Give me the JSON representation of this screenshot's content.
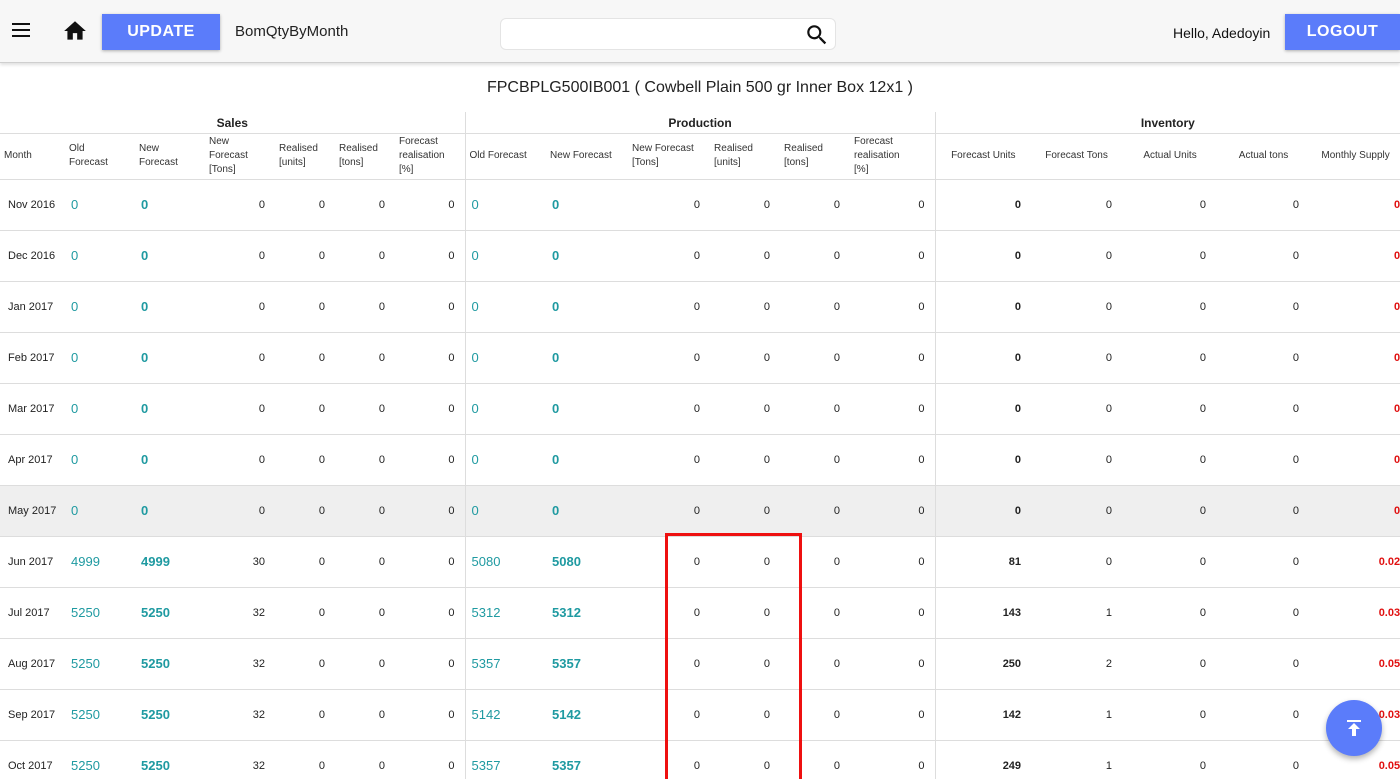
{
  "topbar": {
    "update_label": "UPDATE",
    "page_name": "BomQtyByMonth",
    "search_value": "",
    "greeting": "Hello, Adedoyin",
    "logout_label": "LOGOUT"
  },
  "product_title": "FPCBPLG500IB001 ( Cowbell Plain 500 gr Inner Box 12x1 )",
  "groups": {
    "sales": "Sales",
    "production": "Production",
    "inventory": "Inventory"
  },
  "columns": {
    "month": "Month",
    "sales": [
      "Old\nForecast",
      "New\nForecast",
      "New\nForecast\n[Tons]",
      "Realised\n[units]",
      "Realised\n[tons]",
      "Forecast\nrealisation\n[%]"
    ],
    "production": [
      "Old Forecast",
      "New Forecast",
      "New Forecast\n[Tons]",
      "Realised\n[units]",
      "Realised\n[tons]",
      "Forecast\nrealisation\n[%]"
    ],
    "inventory": [
      "Forecast Units",
      "Forecast Tons",
      "Actual Units",
      "Actual tons",
      "Monthly Supply"
    ]
  },
  "rows": [
    {
      "month": "Nov 2016",
      "s_old": "0",
      "s_new": "0",
      "s_tons": "0",
      "s_real_units": "0",
      "s_real_tons": "0",
      "s_pct": "0",
      "p_old": "0",
      "p_new": "0",
      "p_tons": "0",
      "p_real_units": "0",
      "p_real_tons": "0",
      "p_pct": "0",
      "i_fc_units": "0",
      "i_fc_tons": "0",
      "i_act_units": "0",
      "i_act_tons": "0",
      "i_supply": "0"
    },
    {
      "month": "Dec 2016",
      "s_old": "0",
      "s_new": "0",
      "s_tons": "0",
      "s_real_units": "0",
      "s_real_tons": "0",
      "s_pct": "0",
      "p_old": "0",
      "p_new": "0",
      "p_tons": "0",
      "p_real_units": "0",
      "p_real_tons": "0",
      "p_pct": "0",
      "i_fc_units": "0",
      "i_fc_tons": "0",
      "i_act_units": "0",
      "i_act_tons": "0",
      "i_supply": "0"
    },
    {
      "month": "Jan 2017",
      "s_old": "0",
      "s_new": "0",
      "s_tons": "0",
      "s_real_units": "0",
      "s_real_tons": "0",
      "s_pct": "0",
      "p_old": "0",
      "p_new": "0",
      "p_tons": "0",
      "p_real_units": "0",
      "p_real_tons": "0",
      "p_pct": "0",
      "i_fc_units": "0",
      "i_fc_tons": "0",
      "i_act_units": "0",
      "i_act_tons": "0",
      "i_supply": "0"
    },
    {
      "month": "Feb 2017",
      "s_old": "0",
      "s_new": "0",
      "s_tons": "0",
      "s_real_units": "0",
      "s_real_tons": "0",
      "s_pct": "0",
      "p_old": "0",
      "p_new": "0",
      "p_tons": "0",
      "p_real_units": "0",
      "p_real_tons": "0",
      "p_pct": "0",
      "i_fc_units": "0",
      "i_fc_tons": "0",
      "i_act_units": "0",
      "i_act_tons": "0",
      "i_supply": "0"
    },
    {
      "month": "Mar 2017",
      "s_old": "0",
      "s_new": "0",
      "s_tons": "0",
      "s_real_units": "0",
      "s_real_tons": "0",
      "s_pct": "0",
      "p_old": "0",
      "p_new": "0",
      "p_tons": "0",
      "p_real_units": "0",
      "p_real_tons": "0",
      "p_pct": "0",
      "i_fc_units": "0",
      "i_fc_tons": "0",
      "i_act_units": "0",
      "i_act_tons": "0",
      "i_supply": "0"
    },
    {
      "month": "Apr 2017",
      "s_old": "0",
      "s_new": "0",
      "s_tons": "0",
      "s_real_units": "0",
      "s_real_tons": "0",
      "s_pct": "0",
      "p_old": "0",
      "p_new": "0",
      "p_tons": "0",
      "p_real_units": "0",
      "p_real_tons": "0",
      "p_pct": "0",
      "i_fc_units": "0",
      "i_fc_tons": "0",
      "i_act_units": "0",
      "i_act_tons": "0",
      "i_supply": "0"
    },
    {
      "month": "May 2017",
      "s_old": "0",
      "s_new": "0",
      "s_tons": "0",
      "s_real_units": "0",
      "s_real_tons": "0",
      "s_pct": "0",
      "p_old": "0",
      "p_new": "0",
      "p_tons": "0",
      "p_real_units": "0",
      "p_real_tons": "0",
      "p_pct": "0",
      "i_fc_units": "0",
      "i_fc_tons": "0",
      "i_act_units": "0",
      "i_act_tons": "0",
      "i_supply": "0",
      "highlight": true
    },
    {
      "month": "Jun 2017",
      "s_old": "4999",
      "s_new": "4999",
      "s_tons": "30",
      "s_real_units": "0",
      "s_real_tons": "0",
      "s_pct": "0",
      "p_old": "5080",
      "p_new": "5080",
      "p_tons": "0",
      "p_real_units": "0",
      "p_real_tons": "0",
      "p_pct": "0",
      "i_fc_units": "81",
      "i_fc_tons": "0",
      "i_act_units": "0",
      "i_act_tons": "0",
      "i_supply": "0.02"
    },
    {
      "month": "Jul 2017",
      "s_old": "5250",
      "s_new": "5250",
      "s_tons": "32",
      "s_real_units": "0",
      "s_real_tons": "0",
      "s_pct": "0",
      "p_old": "5312",
      "p_new": "5312",
      "p_tons": "0",
      "p_real_units": "0",
      "p_real_tons": "0",
      "p_pct": "0",
      "i_fc_units": "143",
      "i_fc_tons": "1",
      "i_act_units": "0",
      "i_act_tons": "0",
      "i_supply": "0.03"
    },
    {
      "month": "Aug 2017",
      "s_old": "5250",
      "s_new": "5250",
      "s_tons": "32",
      "s_real_units": "0",
      "s_real_tons": "0",
      "s_pct": "0",
      "p_old": "5357",
      "p_new": "5357",
      "p_tons": "0",
      "p_real_units": "0",
      "p_real_tons": "0",
      "p_pct": "0",
      "i_fc_units": "250",
      "i_fc_tons": "2",
      "i_act_units": "0",
      "i_act_tons": "0",
      "i_supply": "0.05"
    },
    {
      "month": "Sep 2017",
      "s_old": "5250",
      "s_new": "5250",
      "s_tons": "32",
      "s_real_units": "0",
      "s_real_tons": "0",
      "s_pct": "0",
      "p_old": "5142",
      "p_new": "5142",
      "p_tons": "0",
      "p_real_units": "0",
      "p_real_tons": "0",
      "p_pct": "0",
      "i_fc_units": "142",
      "i_fc_tons": "1",
      "i_act_units": "0",
      "i_act_tons": "0",
      "i_supply": "0.03"
    },
    {
      "month": "Oct 2017",
      "s_old": "5250",
      "s_new": "5250",
      "s_tons": "32",
      "s_real_units": "0",
      "s_real_tons": "0",
      "s_pct": "0",
      "p_old": "5357",
      "p_new": "5357",
      "p_tons": "0",
      "p_real_units": "0",
      "p_real_tons": "0",
      "p_pct": "0",
      "i_fc_units": "249",
      "i_fc_tons": "1",
      "i_act_units": "0",
      "i_act_tons": "0",
      "i_supply": "0.05"
    }
  ],
  "colors": {
    "accent": "#5b7cfa",
    "teal_value": "#1f9aa1",
    "supply_red": "#e01010",
    "annotation_red": "#ee1010"
  },
  "icons": {
    "menu": "menu-icon",
    "home": "home-icon",
    "search": "search-icon",
    "scroll_top": "arrow-to-top-icon"
  }
}
